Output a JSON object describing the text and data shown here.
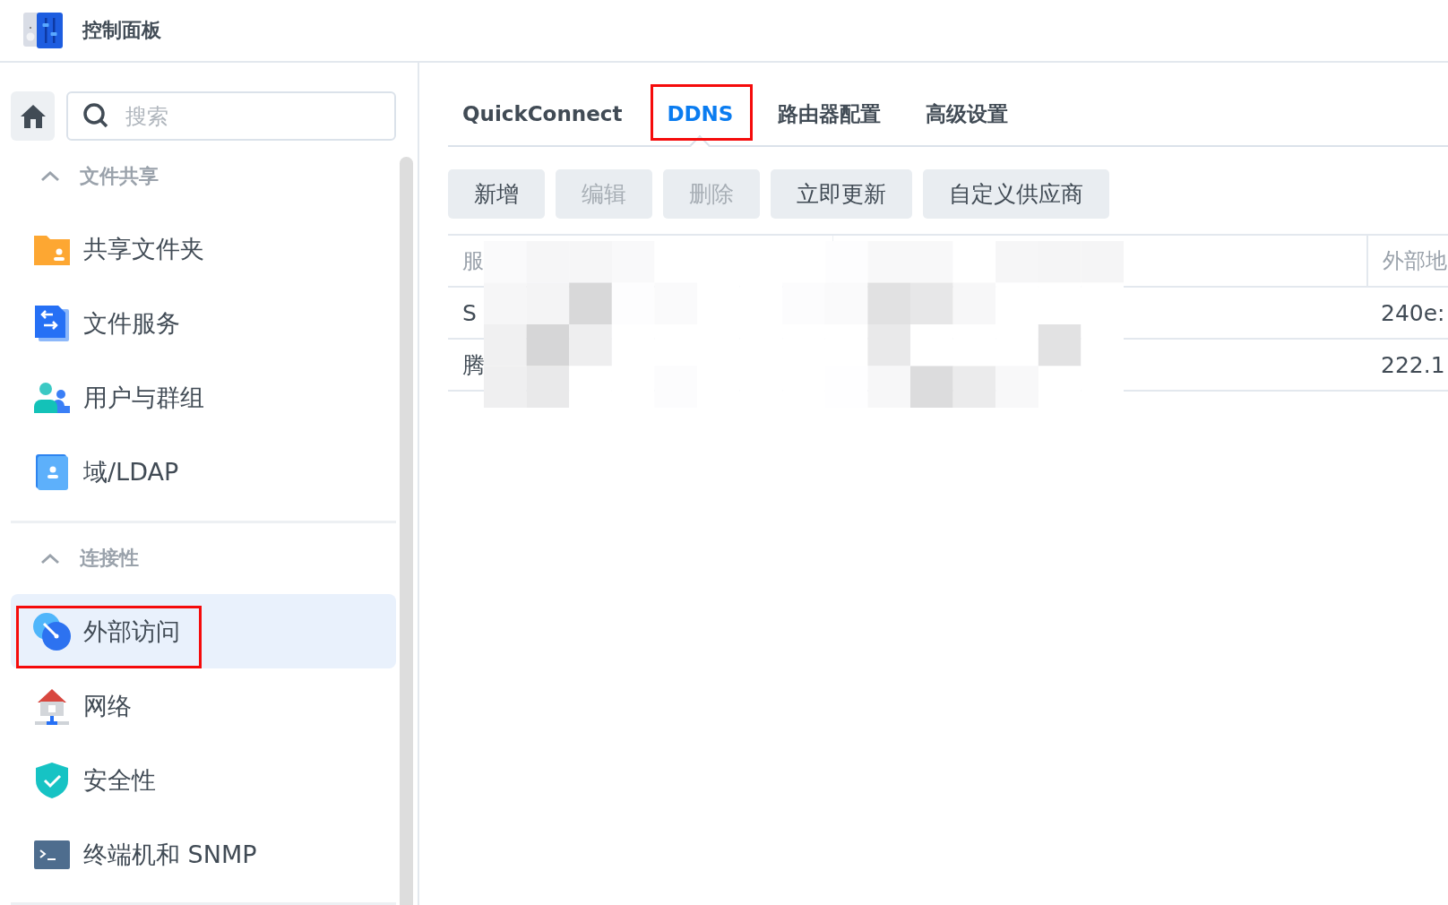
{
  "window": {
    "title": "控制面板"
  },
  "search": {
    "placeholder": "搜索"
  },
  "sidebar": {
    "sections": [
      {
        "title": "文件共享",
        "expanded": true,
        "items": [
          {
            "label": "共享文件夹",
            "selected": false,
            "highlighted": false
          },
          {
            "label": "文件服务",
            "selected": false,
            "highlighted": false
          },
          {
            "label": "用户与群组",
            "selected": false,
            "highlighted": false
          },
          {
            "label": "域/LDAP",
            "selected": false,
            "highlighted": false
          }
        ]
      },
      {
        "title": "连接性",
        "expanded": true,
        "items": [
          {
            "label": "外部访问",
            "selected": true,
            "highlighted": true
          },
          {
            "label": "网络",
            "selected": false,
            "highlighted": false
          },
          {
            "label": "安全性",
            "selected": false,
            "highlighted": false
          },
          {
            "label": "终端机和 SNMP",
            "selected": false,
            "highlighted": false
          }
        ]
      }
    ]
  },
  "tabs": [
    {
      "label": "QuickConnect",
      "selected": false,
      "highlighted": false
    },
    {
      "label": "DDNS",
      "selected": true,
      "highlighted": true
    },
    {
      "label": "路由器配置",
      "selected": false,
      "highlighted": false
    },
    {
      "label": "高级设置",
      "selected": false,
      "highlighted": false
    }
  ],
  "toolbar": [
    {
      "label": "新增",
      "disabled": false
    },
    {
      "label": "编辑",
      "disabled": true
    },
    {
      "label": "删除",
      "disabled": true
    },
    {
      "label": "立即更新",
      "disabled": false
    },
    {
      "label": "自定义供应商",
      "disabled": false
    }
  ],
  "table": {
    "columns": [
      "服",
      "外部地"
    ],
    "rows": [
      [
        "S",
        "240e:"
      ],
      [
        "腾",
        "222.1"
      ]
    ]
  }
}
